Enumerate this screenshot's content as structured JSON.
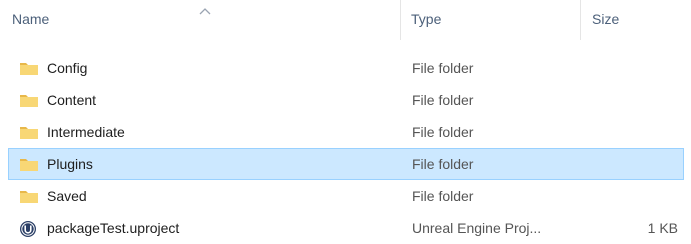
{
  "columns": {
    "name": "Name",
    "type": "Type",
    "size": "Size",
    "sort_icon": "chevron-up-icon"
  },
  "files": [
    {
      "name": "Config",
      "type": "File folder",
      "size": "",
      "icon": "folder-icon",
      "selected": false
    },
    {
      "name": "Content",
      "type": "File folder",
      "size": "",
      "icon": "folder-icon",
      "selected": false
    },
    {
      "name": "Intermediate",
      "type": "File folder",
      "size": "",
      "icon": "folder-icon",
      "selected": false
    },
    {
      "name": "Plugins",
      "type": "File folder",
      "size": "",
      "icon": "folder-icon",
      "selected": true
    },
    {
      "name": "Saved",
      "type": "File folder",
      "size": "",
      "icon": "folder-icon",
      "selected": false
    },
    {
      "name": "packageTest.uproject",
      "type": "Unreal Engine Proj...",
      "size": "1 KB",
      "icon": "unreal-engine-icon",
      "selected": false
    }
  ],
  "colors": {
    "selection_bg": "#cce8ff",
    "selection_border": "#99d1ff",
    "folder": "#f8d775"
  }
}
